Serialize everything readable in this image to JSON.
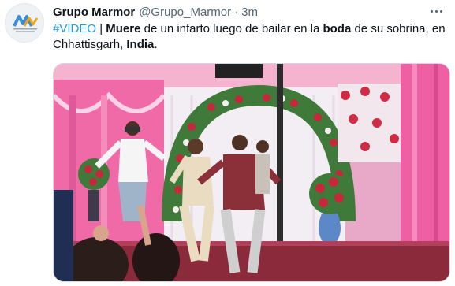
{
  "tweet": {
    "author": {
      "display_name": "Grupo Marmor",
      "handle": "@Grupo_Marmor",
      "avatar_icon": "grupo-marmor-logo"
    },
    "time": "3m",
    "separator": "·",
    "text": {
      "hashtag": "#VIDEO",
      "seg1": " | ",
      "bold1": "Muere",
      "seg2": " de un infarto luego de bailar en la ",
      "bold2": "boda",
      "seg3": " de su sobrina, en Chhattisgarh, ",
      "bold3": "India",
      "seg4": "."
    },
    "menu_icon": "more-dots-icon",
    "media": {
      "kind": "video-still",
      "description_icon": "wedding-dance-video"
    }
  },
  "colors": {
    "link": "#1d9bf0",
    "text": "#0f1419",
    "secondary": "#536471",
    "stage_pink": "#f06aa8",
    "curtain_white": "#f3eef4",
    "floor_red": "#8a2a3a"
  }
}
